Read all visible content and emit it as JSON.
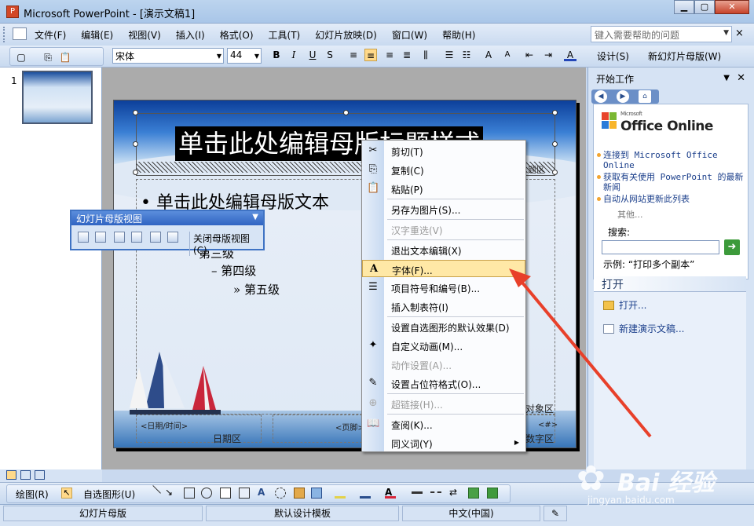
{
  "window": {
    "title": "Microsoft PowerPoint - [演示文稿1]",
    "min": "▁",
    "max": "▢",
    "close": "✕"
  },
  "menu": {
    "items": [
      "文件(F)",
      "编辑(E)",
      "视图(V)",
      "插入(I)",
      "格式(O)",
      "工具(T)",
      "幻灯片放映(D)",
      "窗口(W)",
      "帮助(H)"
    ],
    "help_placeholder": "键入需要帮助的问题",
    "doc_close": "×"
  },
  "toolbar": {
    "font": "宋体",
    "size": "44",
    "design": "设计(S)",
    "new_master": "新幻灯片母版(W)"
  },
  "thumbs": {
    "number": "1"
  },
  "slide": {
    "title": "单击此处编辑母版标题样式",
    "title_area_label": "题区",
    "bullet1": "单击此处编辑母版文本",
    "level3": "第三级",
    "level4": "– 第四级",
    "level5": "» 第五级",
    "date_ph": "<日期/时间>",
    "date_area": "日期区",
    "footer_ph": "<页脚>",
    "object_area": "对象区",
    "number_ph": "<#>",
    "number_area": "数字区"
  },
  "float_toolbar": {
    "title": "幻灯片母版视图",
    "close_master": "关闭母版视图(C)"
  },
  "context_menu": {
    "items": [
      {
        "label": "剪切(T)",
        "icon": "✂",
        "disabled": false
      },
      {
        "label": "复制(C)",
        "icon": "⎘",
        "disabled": false
      },
      {
        "label": "粘贴(P)",
        "icon": "📋",
        "disabled": false
      },
      {
        "label": "另存为图片(S)...",
        "icon": "",
        "disabled": false
      },
      {
        "label": "汉字重选(V)",
        "icon": "",
        "disabled": true
      },
      {
        "label": "退出文本编辑(X)",
        "icon": "",
        "disabled": false
      },
      {
        "label": "字体(F)...",
        "icon": "A",
        "disabled": false
      },
      {
        "label": "项目符号和编号(B)...",
        "icon": "☰",
        "disabled": false
      },
      {
        "label": "插入制表符(I)",
        "icon": "",
        "disabled": false
      },
      {
        "label": "设置自选图形的默认效果(D)",
        "icon": "",
        "disabled": false
      },
      {
        "label": "自定义动画(M)...",
        "icon": "✦",
        "disabled": false
      },
      {
        "label": "动作设置(A)...",
        "icon": "",
        "disabled": true
      },
      {
        "label": "设置占位符格式(O)...",
        "icon": "✎",
        "disabled": false
      },
      {
        "label": "超链接(H)...",
        "icon": "⊕",
        "disabled": true
      },
      {
        "label": "查阅(K)...",
        "icon": "📖",
        "disabled": false
      },
      {
        "label": "同义词(Y)",
        "icon": "",
        "disabled": false
      }
    ],
    "submenu_arrow": "▶"
  },
  "taskpane": {
    "title": "开始工作",
    "office_small": "Microsoft",
    "office_online": "Office Online",
    "links": [
      "连接到 Microsoft Office Online",
      "获取有关使用 PowerPoint 的最新新闻",
      "自动从网站更新此列表"
    ],
    "other": "其他...",
    "search_label": "搜索:",
    "example": "示例: “打印多个副本”",
    "open_section": "打开",
    "open_item": "打开...",
    "new_item": "新建演示文稿..."
  },
  "drawbar": {
    "draw": "绘图(R)",
    "autoshapes": "自选图形(U)"
  },
  "status": {
    "view": "幻灯片母版",
    "template": "默认设计模板",
    "lang": "中文(中国)"
  },
  "watermark": {
    "brand": "Bai 经验",
    "url": "jingyan.baidu.com"
  },
  "colors": {
    "highlight": "#ffe8a6",
    "arrow": "#e8402a"
  }
}
